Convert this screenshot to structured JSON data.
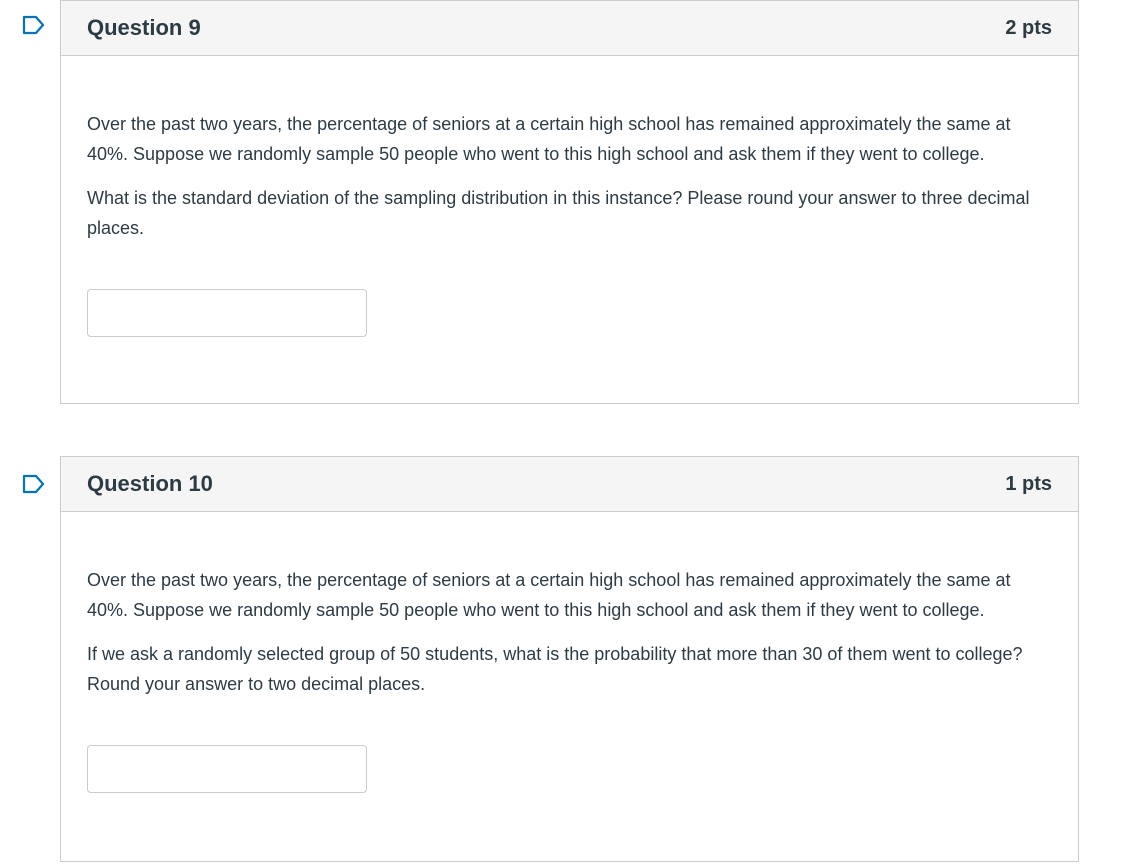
{
  "questions": [
    {
      "title": "Question 9",
      "points": "2 pts",
      "paragraph1": "Over the past two years, the percentage of seniors at a certain high school has remained approximately the same at 40%. Suppose we randomly sample 50 people who went to this high school and ask them if they went to college.",
      "paragraph2": "What is the standard deviation of the sampling distribution in this instance? Please round your answer to three decimal places.",
      "answer_value": ""
    },
    {
      "title": "Question 10",
      "points": "1 pts",
      "paragraph1": "Over the past two years, the percentage of seniors at a certain high school has remained approximately the same at 40%. Suppose we randomly sample 50 people who went to this high school and ask them if they went to college.",
      "paragraph2": "If we ask a randomly selected group of 50 students, what is the probability that more than 30 of them went to college? Round your answer to two decimal places.",
      "answer_value": ""
    }
  ],
  "icons": {
    "flag": "flag-question-icon"
  },
  "colors": {
    "flag_blue": "#0374b5",
    "header_bg": "#f5f5f5",
    "border": "#c7cdd1",
    "text": "#2d3b45"
  }
}
